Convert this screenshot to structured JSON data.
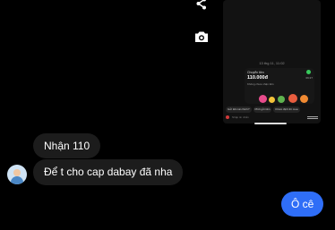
{
  "side_actions": {
    "share_icon": "share-icon",
    "camera_icon": "camera-icon"
  },
  "shared_screenshot": {
    "timestamp": "13 thg 11, 11:02",
    "transaction": {
      "label": "Chuyển tiền",
      "amount": "110.000đ",
      "subtitle": "Không chưa nhận tiền",
      "side_note": "09:27"
    },
    "chips": [
      "Gửi tiền tài chính?",
      "Phối gửi tiền",
      "Khám định thì mua"
    ],
    "input_placeholder": "Nhập tin nhắn"
  },
  "messages": [
    {
      "text": "Nhận 110",
      "direction": "received"
    },
    {
      "text": "Để t cho cap dabay đã nha",
      "direction": "received"
    },
    {
      "text": "Ô cê",
      "direction": "sent"
    }
  ],
  "colors": {
    "background": "#000000",
    "received_bubble": "#1c1c1c",
    "sent_bubble": "#2f6ef7"
  }
}
